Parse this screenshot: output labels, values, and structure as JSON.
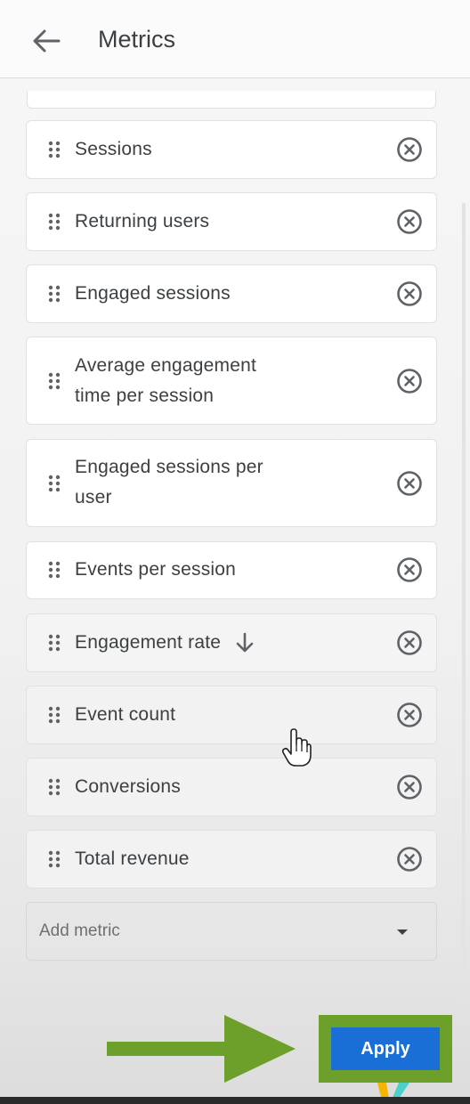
{
  "header": {
    "title": "Metrics",
    "back_icon": "arrow-left-icon"
  },
  "metrics": [
    {
      "label": "Sessions",
      "remove_icon": "close-circle-icon"
    },
    {
      "label": "Returning users",
      "remove_icon": "close-circle-icon"
    },
    {
      "label": "Engaged sessions",
      "remove_icon": "close-circle-icon"
    },
    {
      "label_line1": "Average engagement",
      "label_line2": "time per session",
      "remove_icon": "close-circle-icon"
    },
    {
      "label_line1": "Engaged sessions per",
      "label_line2": "user",
      "remove_icon": "close-circle-icon"
    },
    {
      "label": "Events per session",
      "remove_icon": "close-circle-icon"
    },
    {
      "label": "Engagement rate",
      "sort_icon": "arrow-down-icon",
      "remove_icon": "close-circle-icon"
    },
    {
      "label": "Event count",
      "remove_icon": "close-circle-icon"
    },
    {
      "label": "Conversions",
      "remove_icon": "close-circle-icon"
    },
    {
      "label": "Total revenue",
      "remove_icon": "close-circle-icon"
    }
  ],
  "add_metric": {
    "placeholder": "Add metric",
    "icon": "caret-down-icon"
  },
  "footer": {
    "apply_label": "Apply"
  },
  "colors": {
    "apply_button": "#1a6fd6",
    "highlight": "#6d9f2b"
  }
}
